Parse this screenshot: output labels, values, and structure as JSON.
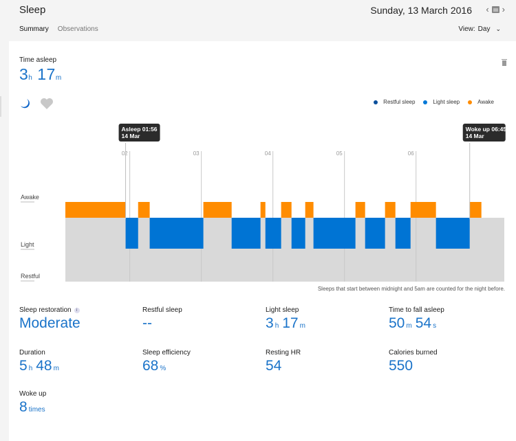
{
  "header": {
    "title": "Sleep",
    "date": "Sunday, 13 March 2016",
    "prev_icon": "‹",
    "next_icon": "›",
    "tabs": [
      {
        "label": "Summary",
        "active": true
      },
      {
        "label": "Observations",
        "active": false
      }
    ],
    "view_label": "View:",
    "view_value": "Day"
  },
  "summary": {
    "time_asleep_label": "Time asleep",
    "time_asleep_hours": "3",
    "time_asleep_minutes": "17",
    "unit_h": "h",
    "unit_m": "m"
  },
  "legend": [
    {
      "label": "Restful sleep",
      "color": "#0b4f9c"
    },
    {
      "label": "Light sleep",
      "color": "#0078d7"
    },
    {
      "label": "Awake",
      "color": "#ff8c00"
    }
  ],
  "colors": {
    "awake": "#ff8c00",
    "light": "#0074d4",
    "background": "#d9d9d9",
    "accent": "#1a73c9"
  },
  "chart_data": {
    "type": "bar",
    "title": "",
    "xlabel": "",
    "ylabel": "",
    "x_unit": "minutes since 00:00, 14 Mar",
    "x_range": [
      66,
      434
    ],
    "x_ticks": [
      {
        "label": "02",
        "minute": 120
      },
      {
        "label": "03",
        "minute": 180
      },
      {
        "label": "04",
        "minute": 240
      },
      {
        "label": "05",
        "minute": 300
      },
      {
        "label": "06",
        "minute": 360
      }
    ],
    "y_levels": [
      "Awake",
      "Light",
      "Restful"
    ],
    "segments": [
      {
        "state": "Awake",
        "start": 66,
        "end": 116.5
      },
      {
        "state": "Light",
        "start": 116.5,
        "end": 127
      },
      {
        "state": "Awake",
        "start": 127,
        "end": 136.7
      },
      {
        "state": "Light",
        "start": 136.7,
        "end": 181.7
      },
      {
        "state": "Awake",
        "start": 181.7,
        "end": 205.4
      },
      {
        "state": "Light",
        "start": 205.4,
        "end": 229.6
      },
      {
        "state": "Awake",
        "start": 229.6,
        "end": 233.7
      },
      {
        "state": "Light",
        "start": 233.7,
        "end": 246.9
      },
      {
        "state": "Awake",
        "start": 246.9,
        "end": 255.6
      },
      {
        "state": "Light",
        "start": 255.6,
        "end": 267.1
      },
      {
        "state": "Awake",
        "start": 267.1,
        "end": 274
      },
      {
        "state": "Light",
        "start": 274,
        "end": 309.2
      },
      {
        "state": "Awake",
        "start": 309.2,
        "end": 317.3
      },
      {
        "state": "Light",
        "start": 317.3,
        "end": 334
      },
      {
        "state": "Awake",
        "start": 334,
        "end": 342.7
      },
      {
        "state": "Light",
        "start": 342.7,
        "end": 355.4
      },
      {
        "state": "Awake",
        "start": 355.4,
        "end": 376.7
      },
      {
        "state": "Light",
        "start": 376.7,
        "end": 405
      },
      {
        "state": "Awake",
        "start": 405,
        "end": 414.8
      }
    ],
    "markers": [
      {
        "label": "Asleep 01:56",
        "sub": "14 Mar",
        "minute": 116.5
      },
      {
        "label": "Woke up 06:45",
        "sub": "14 Mar",
        "minute": 405
      }
    ],
    "footnote": "Sleeps that start between midnight and 5am are counted for the night before."
  },
  "stats": {
    "sleep_restoration": {
      "label": "Sleep restoration",
      "value": "Moderate",
      "info_icon": "i"
    },
    "restful_sleep": {
      "label": "Restful sleep",
      "value": "--"
    },
    "light_sleep": {
      "label": "Light sleep",
      "hours": "3",
      "minutes": "17"
    },
    "time_to_fall_asleep": {
      "label": "Time to fall asleep",
      "minutes": "50",
      "seconds": "54",
      "unit_s": "s"
    },
    "duration": {
      "label": "Duration",
      "hours": "5",
      "minutes": "48"
    },
    "sleep_efficiency": {
      "label": "Sleep efficiency",
      "value": "68",
      "unit": "%"
    },
    "resting_hr": {
      "label": "Resting HR",
      "value": "54"
    },
    "calories_burned": {
      "label": "Calories burned",
      "value": "550"
    },
    "woke_up": {
      "label": "Woke up",
      "value": "8",
      "unit": "times"
    }
  }
}
